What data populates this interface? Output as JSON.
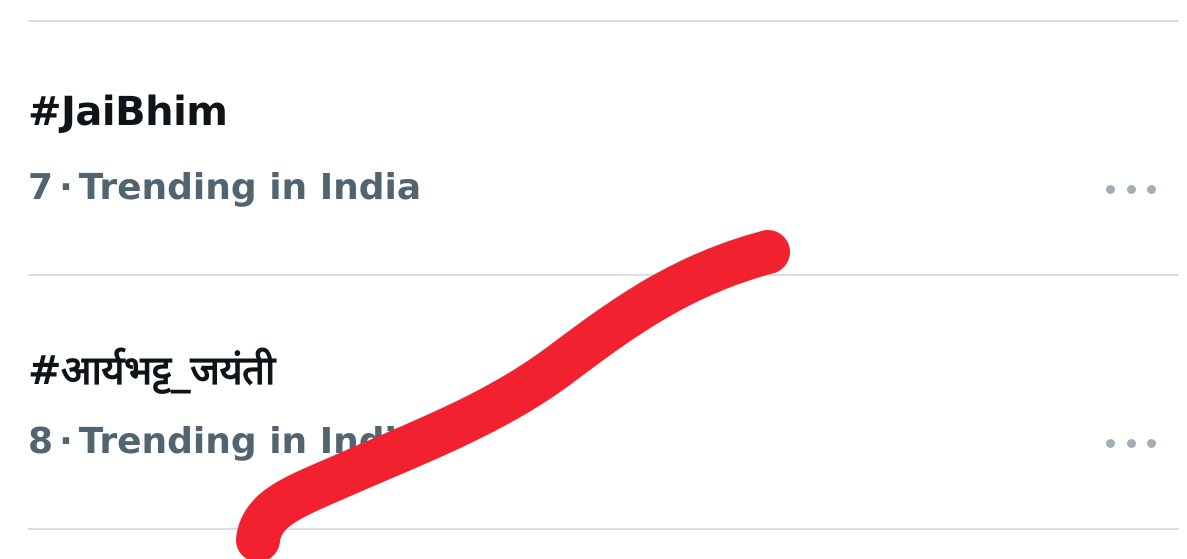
{
  "trends": [
    {
      "rank": "7",
      "separator": "·",
      "context": "Trending in India",
      "title": "#JaiBhim",
      "more_icon": "ellipsis-icon"
    },
    {
      "rank": "8",
      "separator": "·",
      "context": "Trending in India",
      "title": "#आर्यभट्ट_जयंती",
      "more_icon": "ellipsis-icon"
    }
  ],
  "annotation": {
    "stroke_color": "#f2212f"
  },
  "colors": {
    "title": "#0f1419",
    "meta": "#536471",
    "divider": "#dcdfe2",
    "more_dots": "#a3adb6"
  }
}
